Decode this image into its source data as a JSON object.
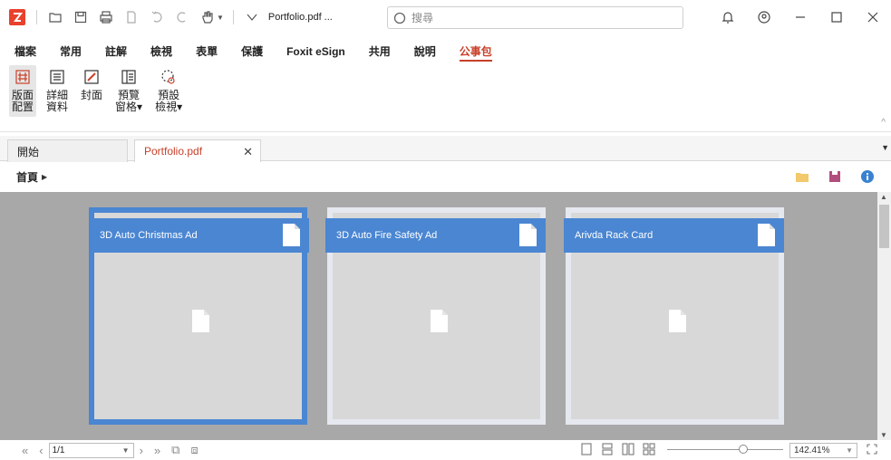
{
  "titlebar": {
    "filename": "Portfolio.pdf ...",
    "search_placeholder": "搜尋"
  },
  "menu": {
    "items": [
      "檔案",
      "常用",
      "註解",
      "檢視",
      "表單",
      "保護",
      "Foxit eSign",
      "共用",
      "說明",
      "公事包"
    ],
    "active_index": 9
  },
  "ribbon": {
    "buttons": [
      {
        "label": "版面\n配置",
        "icon": "layout-icon",
        "active": true
      },
      {
        "label": "詳細\n資料",
        "icon": "details-icon",
        "active": false
      },
      {
        "label": "封面",
        "icon": "cover-icon",
        "active": false
      },
      {
        "label": "預覽\n窗格▾",
        "icon": "preview-pane-icon",
        "active": false
      },
      {
        "label": "預設\n檢視▾",
        "icon": "default-view-icon",
        "active": false
      }
    ]
  },
  "tabs": {
    "home": "開始",
    "doc": "Portfolio.pdf"
  },
  "breadcrumb": {
    "label": "首頁"
  },
  "cards": [
    {
      "title": "3D Auto Christmas Ad",
      "selected": true
    },
    {
      "title": "3D Auto Fire Safety Ad",
      "selected": false
    },
    {
      "title": "Arivda Rack Card",
      "selected": false
    }
  ],
  "statusbar": {
    "page": "1/1",
    "zoom": "142.41%"
  },
  "colors": {
    "accent": "#c8402a",
    "card_blue": "#4a86d2",
    "canvas_gray": "#a8a8a8"
  }
}
